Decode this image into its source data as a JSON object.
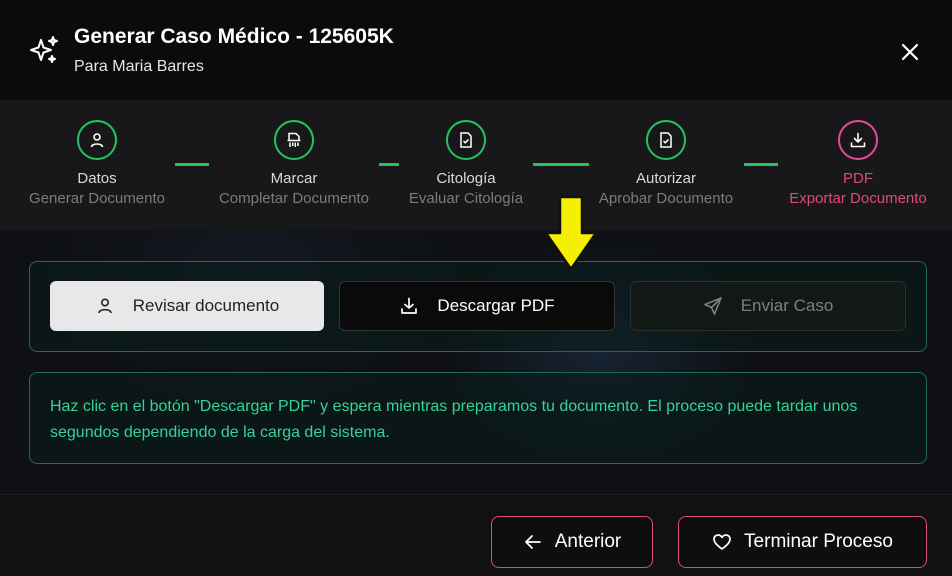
{
  "header": {
    "title": "Generar Caso Médico - 125605K",
    "subtitle": "Para Maria Barres",
    "icon": "sparkles-icon",
    "close_icon": "close-icon"
  },
  "steps": [
    {
      "label": "Datos",
      "sub": "Generar Documento",
      "icon": "user-icon",
      "status": "completed"
    },
    {
      "label": "Marcar",
      "sub": "Completar Documento",
      "icon": "document-shred-icon",
      "status": "completed"
    },
    {
      "label": "Citología",
      "sub": "Evaluar Citología",
      "icon": "document-check-icon",
      "status": "completed"
    },
    {
      "label": "Autorizar",
      "sub": "Aprobar Documento",
      "icon": "document-check-icon",
      "status": "completed"
    },
    {
      "label": "PDF",
      "sub": "Exportar Documento",
      "icon": "download-icon",
      "status": "active"
    }
  ],
  "actions": {
    "review_label": "Revisar documento",
    "download_label": "Descargar PDF",
    "send_label": "Enviar Caso"
  },
  "info": {
    "text": "Haz clic en el botón \"Descargar PDF\" y espera mientras preparamos tu documento. El proceso puede tardar unos segundos dependiendo de la carga del sistema."
  },
  "footer": {
    "prev_label": "Anterior",
    "finish_label": "Terminar Proceso"
  },
  "colors": {
    "success": "#22c55e",
    "accent_pink": "#e0477f",
    "info_text": "#34d399",
    "highlight_arrow": "#f5f000"
  }
}
